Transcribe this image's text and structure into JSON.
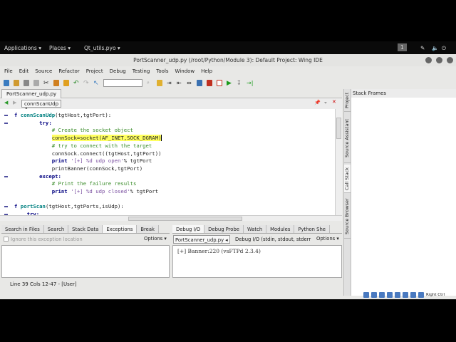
{
  "topbar": {
    "applications": "Applications ▾",
    "places": "Places ▾",
    "active_app": "Qt_utils.pyo ▾",
    "workspace": "1"
  },
  "window": {
    "title": "PortScanner_udp.py (/root/Python/Module 3): Default Project: Wing IDE"
  },
  "menu": [
    "File",
    "Edit",
    "Source",
    "Refactor",
    "Project",
    "Debug",
    "Testing",
    "Tools",
    "Window",
    "Help"
  ],
  "editor": {
    "tab": "PortScanner_udp.py",
    "scope": "connScanUdp",
    "lines": [
      {
        "t": "f ",
        "f": "connScanUdp",
        "r": "(tgtHost,tgtPort):",
        "fold": true
      },
      {
        "k": "        try:",
        "fold": true
      },
      {
        "c": "            # Create the socket object"
      },
      {
        "p": "            ",
        "h": "connSock=socket(AF_INET,SOCK_DGRAM)"
      },
      {
        "c": "            # try to connect with the target"
      },
      {
        "p": "            connSock.connect((tgtHost,tgtPort))"
      },
      {
        "k": "            print ",
        "s": "'[+] %d udp open'",
        "r": "% tgtPort"
      },
      {
        "p": "            printBanner(connSock,tgtPort)"
      },
      {
        "k": "        except:",
        "fold": true
      },
      {
        "c": "            # Print the failure results"
      },
      {
        "k": "            print ",
        "s": "'[+] %d udp closed'",
        "r": "% tgtPort"
      },
      {
        "p": ""
      },
      {
        "t": "f ",
        "f": "portScan",
        "r": "(tgtHost,tgtPorts,isUdp):",
        "fold": true
      },
      {
        "k": "    try:",
        "fold": true
      }
    ]
  },
  "side_tabs": [
    "Project",
    "Source Assistant",
    "Call Stack",
    "Source Browser"
  ],
  "stack_frames": {
    "header": "Stack Frames"
  },
  "left_panel": {
    "tabs": [
      "Search in Files",
      "Search",
      "Stack Data",
      "Exceptions",
      "Break"
    ],
    "active": "Exceptions",
    "checkbox_label": "Ignore this exception location",
    "options": "Options ▾"
  },
  "right_panel": {
    "tabs": [
      "Debug I/O",
      "Debug Probe",
      "Watch",
      "Modules",
      "Python She"
    ],
    "active": "Debug I/O",
    "process": "PortScanner_udp.py ◂",
    "io_label": "Debug I/O (stdin, stdout, stderr",
    "options": "Options ▾",
    "output": "[+] Banner:220 (vsFTPd 2.3.4)"
  },
  "status": "Line 39 Cols 12-47 - [User]",
  "tray": {
    "label": "Right Ctrl"
  }
}
